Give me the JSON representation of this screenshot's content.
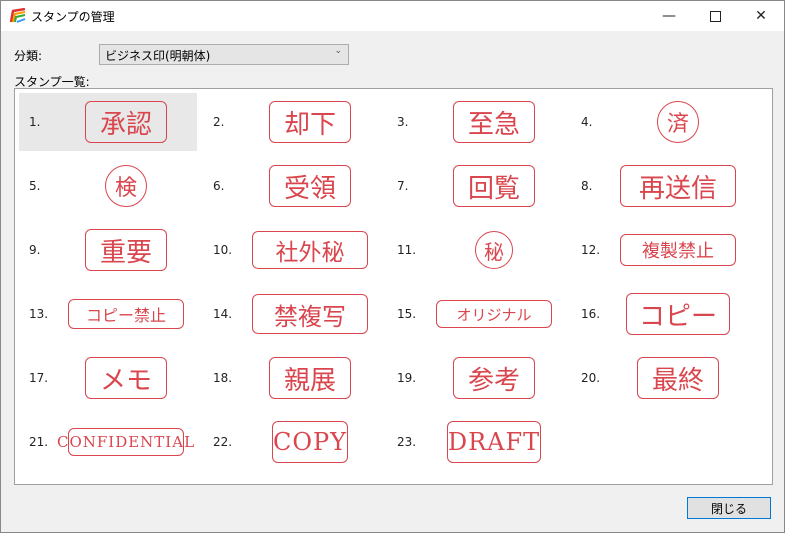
{
  "window": {
    "title": "スタンプの管理",
    "minimize_icon": "minimize-icon",
    "maximize_icon": "maximize-icon",
    "close_icon": "close-icon"
  },
  "category": {
    "label": "分類:",
    "selected": "ビジネス印(明朝体)"
  },
  "list": {
    "label": "スタンプ一覧:",
    "selected_index": 0,
    "items": [
      {
        "num": "1.",
        "text": "承認",
        "shape": "rounded-rect"
      },
      {
        "num": "2.",
        "text": "却下",
        "shape": "rounded-rect"
      },
      {
        "num": "3.",
        "text": "至急",
        "shape": "rounded-rect"
      },
      {
        "num": "4.",
        "text": "済",
        "shape": "circle"
      },
      {
        "num": "5.",
        "text": "検",
        "shape": "circle"
      },
      {
        "num": "6.",
        "text": "受領",
        "shape": "rounded-rect"
      },
      {
        "num": "7.",
        "text": "回覧",
        "shape": "rounded-rect"
      },
      {
        "num": "8.",
        "text": "再送信",
        "shape": "rounded-rect"
      },
      {
        "num": "9.",
        "text": "重要",
        "shape": "rounded-rect"
      },
      {
        "num": "10.",
        "text": "社外秘",
        "shape": "rounded-rect"
      },
      {
        "num": "11.",
        "text": "秘",
        "shape": "circle"
      },
      {
        "num": "12.",
        "text": "複製禁止",
        "shape": "rounded-rect"
      },
      {
        "num": "13.",
        "text": "コピー禁止",
        "shape": "rounded-rect"
      },
      {
        "num": "14.",
        "text": "禁複写",
        "shape": "rounded-rect"
      },
      {
        "num": "15.",
        "text": "オリジナル",
        "shape": "rounded-rect"
      },
      {
        "num": "16.",
        "text": "コピー",
        "shape": "rounded-rect"
      },
      {
        "num": "17.",
        "text": "メモ",
        "shape": "rounded-rect"
      },
      {
        "num": "18.",
        "text": "親展",
        "shape": "rounded-rect"
      },
      {
        "num": "19.",
        "text": "参考",
        "shape": "rounded-rect"
      },
      {
        "num": "20.",
        "text": "最終",
        "shape": "rounded-rect"
      },
      {
        "num": "21.",
        "text": "CONFIDENTIAL",
        "shape": "rounded-rect"
      },
      {
        "num": "22.",
        "text": "COPY",
        "shape": "rounded-rect"
      },
      {
        "num": "23.",
        "text": "DRAFT",
        "shape": "rounded-rect"
      }
    ]
  },
  "buttons": {
    "close": "閉じる"
  },
  "colors": {
    "stamp": "#d9464e",
    "selection": "#e8e8e8",
    "button_border": "#0078d7"
  }
}
